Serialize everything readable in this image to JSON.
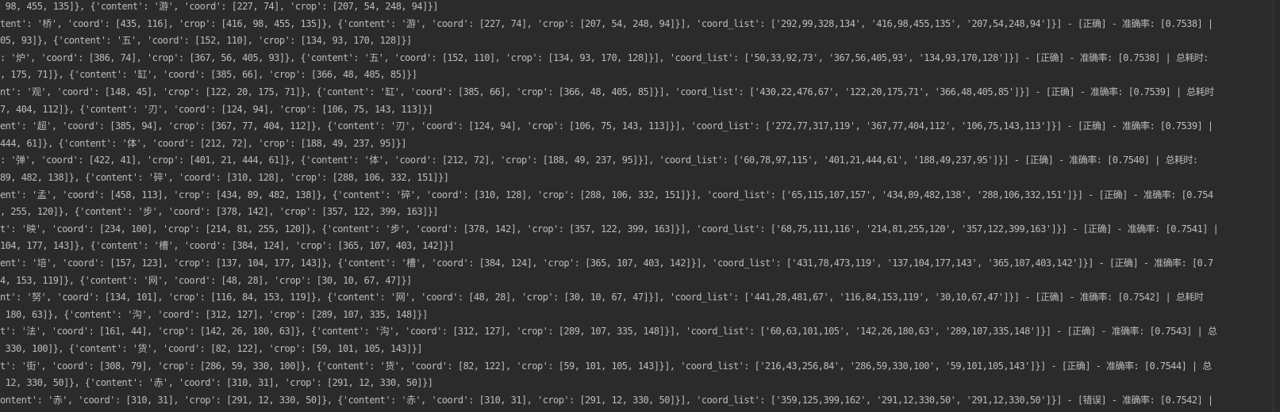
{
  "console": {
    "lines": [
      " 98, 455, 135]}, {'content': '游', 'coord': [227, 74], 'crop': [207, 54, 248, 94]}]",
      "tent': '桥', 'coord': [435, 116], 'crop': [416, 98, 455, 135]}, {'content': '游', 'coord': [227, 74], 'crop': [207, 54, 248, 94]}], 'coord_list': ['292,99,328,134', '416,98,455,135', '207,54,248,94']}] - [正确] - 准确率: [0.7538] |",
      "05, 93]}, {'content': '五', 'coord': [152, 110], 'crop': [134, 93, 170, 128]}]",
      ": '炉', 'coord': [386, 74], 'crop': [367, 56, 405, 93]}, {'content': '五', 'coord': [152, 110], 'crop': [134, 93, 170, 128]}], 'coord_list': ['50,33,92,73', '367,56,405,93', '134,93,170,128']}] - [正确] - 准确率: [0.7538] | 总耗时:",
      ", 175, 71]}, {'content': '缸', 'coord': [385, 66], 'crop': [366, 48, 405, 85]}]",
      "nt': '观', 'coord': [148, 45], 'crop': [122, 20, 175, 71]}, {'content': '缸', 'coord': [385, 66], 'crop': [366, 48, 405, 85]}], 'coord_list': ['430,22,476,67', '122,20,175,71', '366,48,405,85']}] - [正确] - 准确率: [0.7539] | 总耗时",
      "7, 404, 112]}, {'content': '刃', 'coord': [124, 94], 'crop': [106, 75, 143, 113]}]",
      "ent': '超', 'coord': [385, 94], 'crop': [367, 77, 404, 112]}, {'content': '刃', 'coord': [124, 94], 'crop': [106, 75, 143, 113]}], 'coord_list': ['272,77,317,119', '367,77,404,112', '106,75,143,113']}] - [正确] - 准确率: [0.7539] |",
      "444, 61]}, {'content': '体', 'coord': [212, 72], 'crop': [188, 49, 237, 95]}]",
      ": '弹', 'coord': [422, 41], 'crop': [401, 21, 444, 61]}, {'content': '体', 'coord': [212, 72], 'crop': [188, 49, 237, 95]}], 'coord_list': ['60,78,97,115', '401,21,444,61', '188,49,237,95']}] - [正确] - 准确率: [0.7540] | 总耗时:",
      "89, 482, 138]}, {'content': '碎', 'coord': [310, 128], 'crop': [288, 106, 332, 151]}]",
      "ent': '孟', 'coord': [458, 113], 'crop': [434, 89, 482, 138]}, {'content': '碎', 'coord': [310, 128], 'crop': [288, 106, 332, 151]}], 'coord_list': ['65,115,107,157', '434,89,482,138', '288,106,332,151']}] - [正确] - 准确率: [0.754",
      ", 255, 120]}, {'content': '步', 'coord': [378, 142], 'crop': [357, 122, 399, 163]}]",
      "t': '映', 'coord': [234, 100], 'crop': [214, 81, 255, 120]}, {'content': '步', 'coord': [378, 142], 'crop': [357, 122, 399, 163]}], 'coord_list': ['68,75,111,116', '214,81,255,120', '357,122,399,163']}] - [正确] - 准确率: [0.7541] |",
      "104, 177, 143]}, {'content': '槽', 'coord': [384, 124], 'crop': [365, 107, 403, 142]}]",
      "ent': '培', 'coord': [157, 123], 'crop': [137, 104, 177, 143]}, {'content': '槽', 'coord': [384, 124], 'crop': [365, 107, 403, 142]}], 'coord_list': ['431,78,473,119', '137,104,177,143', '365,107,403,142']}] - [正确] - 准确率: [0.7",
      "4, 153, 119]}, {'content': '网', 'coord': [48, 28], 'crop': [30, 10, 67, 47]}]",
      "nt': '努', 'coord': [134, 101], 'crop': [116, 84, 153, 119]}, {'content': '网', 'coord': [48, 28], 'crop': [30, 10, 67, 47]}], 'coord_list': ['441,28,481,67', '116,84,153,119', '30,10,67,47']}] - [正确] - 准确率: [0.7542] | 总耗时",
      " 180, 63]}, {'content': '沟', 'coord': [312, 127], 'crop': [289, 107, 335, 148]}]",
      "t': '法', 'coord': [161, 44], 'crop': [142, 26, 180, 63]}, {'content': '沟', 'coord': [312, 127], 'crop': [289, 107, 335, 148]}], 'coord_list': ['60,63,101,105', '142,26,180,63', '289,107,335,148']}] - [正确] - 准确率: [0.7543] | 总",
      " 330, 100]}, {'content': '货', 'coord': [82, 122], 'crop': [59, 101, 105, 143]}]",
      "t': '街', 'coord': [308, 79], 'crop': [286, 59, 330, 100]}, {'content': '货', 'coord': [82, 122], 'crop': [59, 101, 105, 143]}], 'coord_list': ['216,43,256,84', '286,59,330,100', '59,101,105,143']}] - [正确] - 准确率: [0.7544] | 总",
      " 12, 330, 50]}, {'content': '赤', 'coord': [310, 31], 'crop': [291, 12, 330, 50]}]",
      "ontent': '赤', 'coord': [310, 31], 'crop': [291, 12, 330, 50]}, {'content': '赤', 'coord': [310, 31], 'crop': [291, 12, 330, 50]}], 'coord_list': ['359,125,399,162', '291,12,330,50', '291,12,330,50']}] - [错误] - 准确率: [0.7542] |"
    ]
  },
  "colors": {
    "background": "#2b2b2b",
    "text": "#bcbcbc"
  }
}
